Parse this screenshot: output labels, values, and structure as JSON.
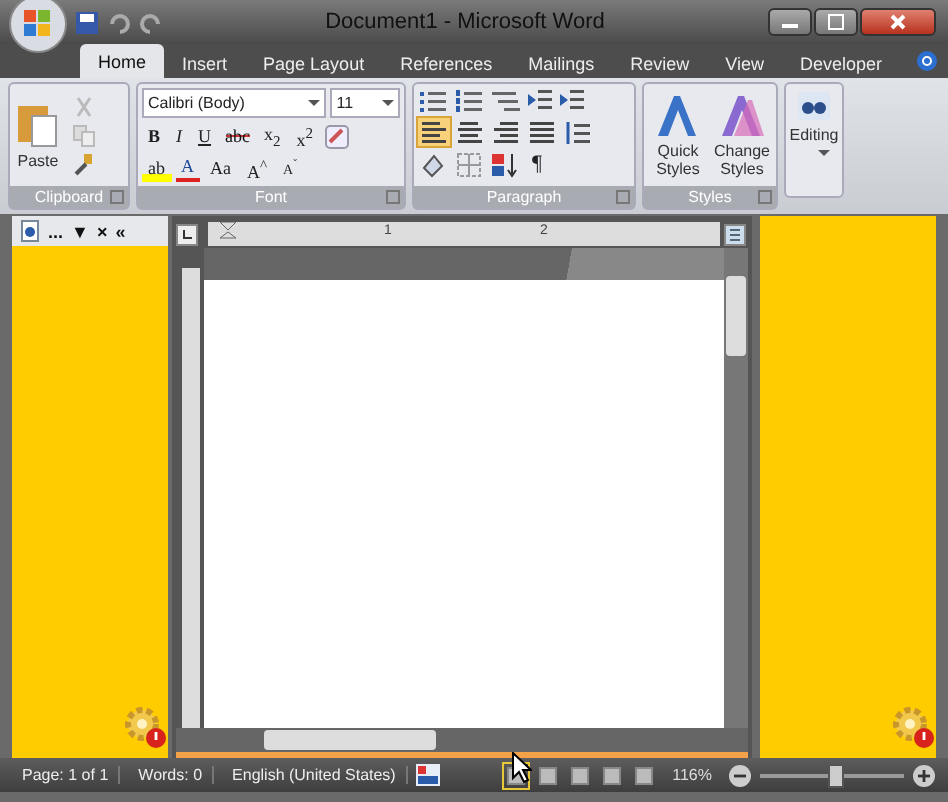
{
  "window": {
    "title": "Document1 - Microsoft Word"
  },
  "tabs": [
    {
      "label": "Home",
      "selected": true
    },
    {
      "label": "Insert",
      "selected": false
    },
    {
      "label": "Page Layout",
      "selected": false
    },
    {
      "label": "References",
      "selected": false
    },
    {
      "label": "Mailings",
      "selected": false
    },
    {
      "label": "Review",
      "selected": false
    },
    {
      "label": "View",
      "selected": false
    },
    {
      "label": "Developer",
      "selected": false
    }
  ],
  "ribbon": {
    "clipboard": {
      "label": "Clipboard",
      "paste": "Paste"
    },
    "font": {
      "label": "Font",
      "font_name": "Calibri (Body)",
      "font_size": "11",
      "row1": [
        {
          "label": "B",
          "kind": "bold"
        },
        {
          "label": "I",
          "kind": "italic"
        },
        {
          "label": "U",
          "kind": "underline"
        },
        {
          "label": "abc",
          "kind": "strike"
        },
        {
          "label": "x$_{2}$",
          "kind": "plain"
        },
        {
          "label": "x$^{2}$",
          "kind": "plain"
        }
      ],
      "row2": [
        {
          "label": "ab",
          "kind": "highlight"
        },
        {
          "label": "A",
          "kind": "color"
        },
        {
          "label": "Aa",
          "kind": "plain"
        },
        {
          "label": "A$^{^}$",
          "kind": "plain"
        },
        {
          "label": "A$^{ˇ}$",
          "kind": "small"
        }
      ]
    },
    "paragraph": {
      "label": "Paragraph",
      "alignments": [
        {
          "selected": true
        },
        {
          "selected": false
        },
        {
          "selected": false
        },
        {
          "selected": false
        }
      ],
      "pilcrow": "¶"
    },
    "styles": {
      "label": "Styles",
      "buttons": [
        "Quick Styles",
        "Change Styles"
      ]
    },
    "editing": {
      "label": "Editing"
    }
  },
  "task_pane": {
    "more": "...",
    "dropdown": "▼",
    "close": "×",
    "collapse": "«"
  },
  "ruler": [
    "1",
    "2"
  ],
  "status_bar": {
    "items": [
      "Page: 1 of 1",
      "Words: 0",
      "English (United States)"
    ],
    "views": [
      {
        "selected": true
      },
      {
        "selected": false
      },
      {
        "selected": false
      },
      {
        "selected": false
      },
      {
        "selected": false
      }
    ],
    "zoom": "116%",
    "zoom_slider": {
      "level": 0.52
    }
  }
}
